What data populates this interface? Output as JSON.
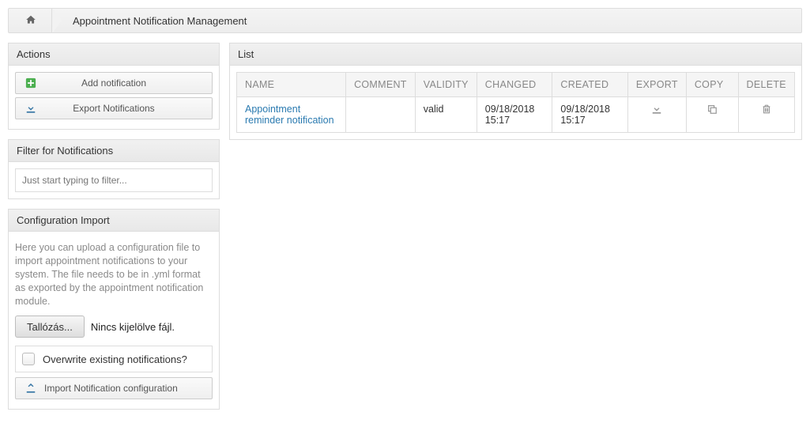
{
  "breadcrumb": {
    "title": "Appointment Notification Management"
  },
  "actions": {
    "header": "Actions",
    "add_label": "Add notification",
    "export_label": "Export Notifications"
  },
  "filter": {
    "header": "Filter for Notifications",
    "placeholder": "Just start typing to filter..."
  },
  "config": {
    "header": "Configuration Import",
    "description": "Here you can upload a configuration file to import appointment notifications to your system. The file needs to be in .yml format as exported by the appointment notification module.",
    "browse_label": "Tallózás...",
    "file_status": "Nincs kijelölve fájl.",
    "overwrite_label": "Overwrite existing notifications?",
    "import_label": "Import Notification configuration"
  },
  "list": {
    "header": "List",
    "columns": {
      "name": "NAME",
      "comment": "COMMENT",
      "validity": "VALIDITY",
      "changed": "CHANGED",
      "created": "CREATED",
      "export": "EXPORT",
      "copy": "COPY",
      "delete": "DELETE"
    },
    "rows": [
      {
        "name": "Appointment reminder notification",
        "comment": "",
        "validity": "valid",
        "changed": "09/18/2018 15:17",
        "created": "09/18/2018 15:17"
      }
    ]
  }
}
